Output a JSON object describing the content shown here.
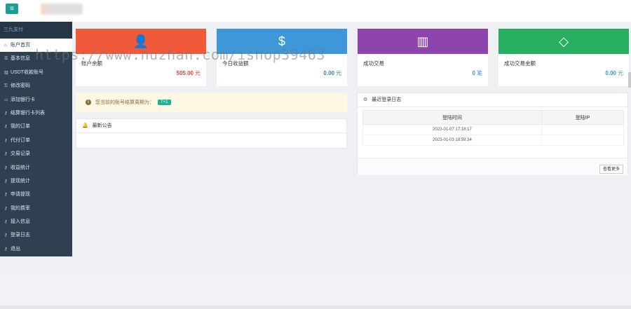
{
  "topbar": {
    "menu_icon": "≡"
  },
  "sidebar": {
    "header": "三九支付",
    "items": [
      {
        "icon": "home-icon",
        "label": "账户首页",
        "active": true
      },
      {
        "icon": "list-icon",
        "label": "基本信息"
      },
      {
        "icon": "chart-icon",
        "label": "USDT收款账号"
      },
      {
        "icon": "lock-icon",
        "label": "修改密码"
      },
      {
        "icon": "card-icon",
        "label": "添加银行卡"
      },
      {
        "icon": "key-icon",
        "label": "结算银行卡列表"
      },
      {
        "icon": "key-icon",
        "label": "我的订单"
      },
      {
        "icon": "key-icon",
        "label": "代付订单"
      },
      {
        "icon": "key-icon",
        "label": "交易记录"
      },
      {
        "icon": "key-icon",
        "label": "收益统计"
      },
      {
        "icon": "key-icon",
        "label": "提现统计"
      },
      {
        "icon": "key-icon",
        "label": "申请提现"
      },
      {
        "icon": "key-icon",
        "label": "我的费率"
      },
      {
        "icon": "key-icon",
        "label": "接入信息"
      },
      {
        "icon": "key-icon",
        "label": "登录日志"
      },
      {
        "icon": "key-icon",
        "label": "退出"
      }
    ]
  },
  "cards": [
    {
      "title": "账户余额",
      "value": "505.00",
      "unit": "元",
      "color": "#f05a3b",
      "value_color": "#e0433a",
      "icon": "user-icon",
      "glyph": "👤"
    },
    {
      "title": "今日收益额",
      "value": "0.00",
      "unit": "元",
      "color": "#3d97d8",
      "value_color": "#3d84c8",
      "icon": "dollar-icon",
      "glyph": "$"
    },
    {
      "title": "成功交易",
      "value": "0",
      "unit": "笔",
      "color": "#8e44ad",
      "value_color": "#3d97d8",
      "icon": "bar-chart-icon",
      "glyph": "▥"
    },
    {
      "title": "成功交易金额",
      "value": "0.00",
      "unit": "元",
      "color": "#27ae60",
      "value_color": "#3d97d8",
      "icon": "diamond-icon",
      "glyph": "◇"
    }
  ],
  "notice": {
    "text": "您当前的账号结算周期为：",
    "badge": "T+1"
  },
  "announcement": {
    "title": "最新公告"
  },
  "login_log": {
    "title": "最近登录日志",
    "columns": [
      "登陆时间",
      "登陆IP"
    ],
    "rows": [
      [
        "2023-01-07 17:18:17",
        ""
      ],
      [
        "2023-01-03 18:59:34",
        ""
      ]
    ],
    "more_label": "查看更多"
  },
  "watermark": "https://www.huzhan.com/ishop39463"
}
